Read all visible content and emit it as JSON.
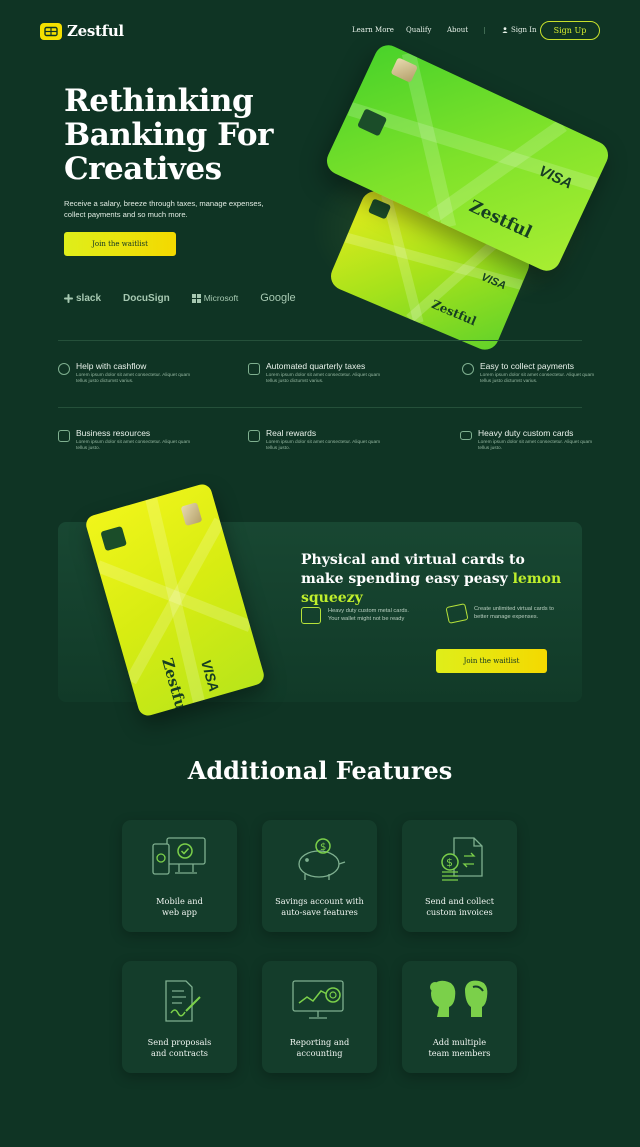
{
  "brand": {
    "name": "Zestful"
  },
  "nav": {
    "links": [
      "Learn More",
      "Qualify",
      "About"
    ],
    "signin": "Sign In",
    "signup": "Sign Up"
  },
  "hero": {
    "title": "Rethinking Banking For Creatives",
    "subtitle": "Receive a salary, breeze through taxes, manage expenses, collect payments and so much more.",
    "cta": "Join the waitlist",
    "partners": [
      "slack",
      "DocuSign",
      "Microsoft",
      "Google"
    ]
  },
  "cards": {
    "brand": "Zestful",
    "network": "VISA"
  },
  "features": [
    {
      "title": "Help with cashflow",
      "desc": "Lorem ipsum dolor sit amet consectetur. Aliquet quam tellus justo dictumst varius."
    },
    {
      "title": "Automated quarterly taxes",
      "desc": "Lorem ipsum dolor sit amet consectetur. Aliquet quam tellus justo dictumst varius."
    },
    {
      "title": "Easy to collect payments",
      "desc": "Lorem ipsum dolor sit amet consectetur. Aliquet quam tellus justo dictumst varius."
    },
    {
      "title": "Business resources",
      "desc": "Lorem ipsum dolor sit amet consectetur. Aliquet quam tellus justo."
    },
    {
      "title": "Real rewards",
      "desc": "Lorem ipsum dolor sit amet consectetur. Aliquet quam tellus justo."
    },
    {
      "title": "Heavy duty custom cards",
      "desc": "Lorem ipsum dolor sit amet consectetur. Aliquet quam tellus justo."
    }
  ],
  "promo": {
    "title_main": "Physical and virtual cards to make spending easy peasy ",
    "title_highlight": "lemon squeezy",
    "item1": "Heavy duty custom metal cards. Your wallet might not be ready",
    "item2": "Create unlimited virtual cards to better manage expenses.",
    "cta": "Join the waitlist"
  },
  "additional": {
    "title": "Additional Features",
    "tiles": [
      {
        "line1": "Mobile and",
        "line2": "web app"
      },
      {
        "line1": "Savings account with",
        "line2": "auto-save features"
      },
      {
        "line1": "Send and collect",
        "line2": "custom invoices"
      },
      {
        "line1": "Send proposals",
        "line2": "and contracts"
      },
      {
        "line1": "Reporting and",
        "line2": "accounting"
      },
      {
        "line1": "Add multiple",
        "line2": "team members"
      }
    ]
  },
  "colors": {
    "background": "#0f3424",
    "accent": "#c9e22c",
    "button": "#f4d900"
  }
}
